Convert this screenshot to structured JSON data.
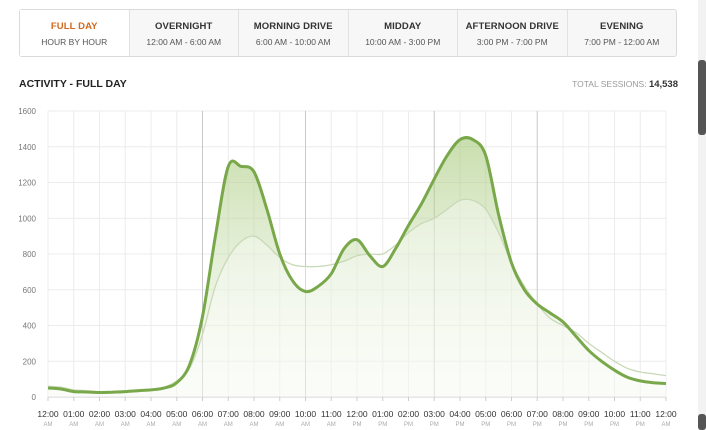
{
  "tabs": [
    {
      "title": "FULL DAY",
      "sub": "HOUR BY HOUR",
      "active": true
    },
    {
      "title": "OVERNIGHT",
      "sub": "12:00 AM - 6:00 AM",
      "active": false
    },
    {
      "title": "MORNING DRIVE",
      "sub": "6:00 AM - 10:00 AM",
      "active": false
    },
    {
      "title": "MIDDAY",
      "sub": "10:00 AM - 3:00 PM",
      "active": false
    },
    {
      "title": "AFTERNOON DRIVE",
      "sub": "3:00 PM - 7:00 PM",
      "active": false
    },
    {
      "title": "EVENING",
      "sub": "7:00 PM - 12:00 AM",
      "active": false
    }
  ],
  "chart_title": "ACTIVITY - FULL DAY",
  "total_label": "TOTAL SESSIONS:",
  "total_value": "14,538",
  "colors": {
    "primary": "#79a84a",
    "comparison": "#c9d9b8",
    "active_tab": "#d2691e"
  },
  "chart_data": {
    "type": "area",
    "title": "ACTIVITY - FULL DAY",
    "ylim": [
      0,
      1600
    ],
    "yticks": [
      0,
      200,
      400,
      600,
      800,
      1000,
      1200,
      1400,
      1600
    ],
    "x": [
      0,
      0.5,
      1,
      1.5,
      2,
      2.5,
      3,
      3.5,
      4,
      4.5,
      5,
      5.5,
      6,
      6.5,
      7,
      7.5,
      8,
      8.5,
      9,
      9.5,
      10,
      10.5,
      11,
      11.5,
      12,
      12.5,
      13,
      13.5,
      14,
      14.5,
      15,
      15.5,
      16,
      16.5,
      17,
      17.5,
      18,
      18.5,
      19,
      19.5,
      20,
      20.5,
      21,
      21.5,
      22,
      22.5,
      23,
      23.5,
      24
    ],
    "xtick_labels": [
      "12:00",
      "01:00",
      "02:00",
      "03:00",
      "04:00",
      "05:00",
      "06:00",
      "07:00",
      "08:00",
      "09:00",
      "10:00",
      "11:00",
      "12:00",
      "01:00",
      "02:00",
      "03:00",
      "04:00",
      "05:00",
      "06:00",
      "07:00",
      "08:00",
      "09:00",
      "10:00",
      "11:00",
      "12:00"
    ],
    "xtick_sub": [
      "AM",
      "AM",
      "AM",
      "AM",
      "AM",
      "AM",
      "AM",
      "AM",
      "AM",
      "AM",
      "AM",
      "AM",
      "PM",
      "PM",
      "PM",
      "PM",
      "PM",
      "PM",
      "PM",
      "PM",
      "PM",
      "PM",
      "PM",
      "PM",
      "AM"
    ],
    "series": [
      {
        "values": [
          50,
          45,
          30,
          28,
          25,
          27,
          30,
          35,
          40,
          50,
          80,
          180,
          450,
          900,
          1290,
          1290,
          1260,
          1050,
          800,
          650,
          590,
          620,
          690,
          830,
          880,
          790,
          730,
          830,
          960,
          1080,
          1220,
          1350,
          1440,
          1440,
          1350,
          1020,
          750,
          600,
          520,
          470,
          420,
          340,
          260,
          200,
          150,
          110,
          90,
          80,
          75
        ]
      },
      {
        "values": [
          60,
          55,
          40,
          35,
          30,
          32,
          35,
          40,
          45,
          55,
          90,
          160,
          350,
          620,
          780,
          870,
          900,
          850,
          780,
          740,
          730,
          730,
          740,
          760,
          790,
          800,
          800,
          850,
          920,
          970,
          1000,
          1050,
          1100,
          1100,
          1050,
          920,
          750,
          620,
          520,
          440,
          400,
          360,
          300,
          250,
          200,
          160,
          140,
          130,
          120
        ]
      }
    ]
  }
}
